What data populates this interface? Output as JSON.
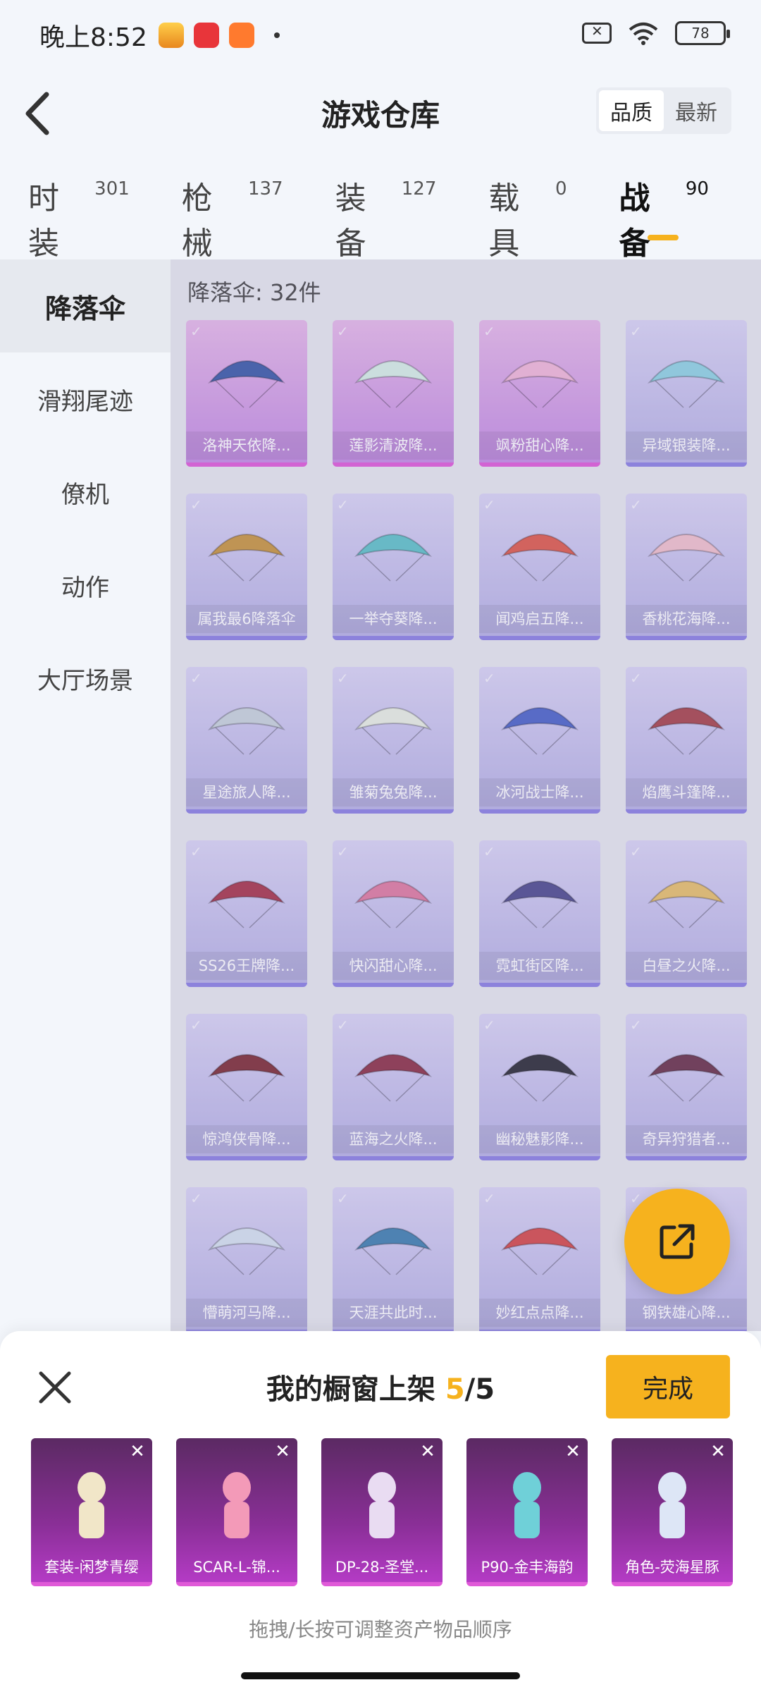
{
  "status": {
    "time": "晚上8:52",
    "battery": "78"
  },
  "header": {
    "title": "游戏仓库",
    "sort_options": [
      "品质",
      "最新"
    ],
    "sort_active": 0
  },
  "tabs": [
    {
      "label": "时装",
      "count": "301"
    },
    {
      "label": "枪械",
      "count": "137"
    },
    {
      "label": "装备",
      "count": "127"
    },
    {
      "label": "载具",
      "count": "0"
    },
    {
      "label": "战备",
      "count": "90"
    }
  ],
  "sidebar": {
    "items": [
      "降落伞",
      "滑翔尾迹",
      "僚机",
      "动作",
      "大厅场景"
    ]
  },
  "grid": {
    "heading": "降落伞: 32件",
    "items": [
      {
        "name": "洛神天依降...",
        "rarity": "legend",
        "color": "#3a5aa8"
      },
      {
        "name": "莲影清波降...",
        "rarity": "legend",
        "color": "#d7efe6"
      },
      {
        "name": "飒粉甜心降...",
        "rarity": "legend",
        "color": "#f2b8d8"
      },
      {
        "name": "异域银装降...",
        "rarity": "epic",
        "color": "#8fd3e3"
      },
      {
        "name": "属我最6降落伞",
        "rarity": "epic",
        "color": "#c8953e"
      },
      {
        "name": "一举夺葵降...",
        "rarity": "epic",
        "color": "#5fc3c8"
      },
      {
        "name": "闻鸡启五降...",
        "rarity": "epic",
        "color": "#e05a4a"
      },
      {
        "name": "香桃花海降...",
        "rarity": "epic",
        "color": "#f2c1cc"
      },
      {
        "name": "星途旅人降...",
        "rarity": "epic",
        "color": "#c9d3dc"
      },
      {
        "name": "雏菊兔兔降...",
        "rarity": "epic",
        "color": "#e9f0e3"
      },
      {
        "name": "冰河战士降...",
        "rarity": "epic",
        "color": "#4b63c9"
      },
      {
        "name": "焰鹰斗篷降...",
        "rarity": "epic",
        "color": "#a8434a"
      },
      {
        "name": "SS26王牌降...",
        "rarity": "epic",
        "color": "#a8344a"
      },
      {
        "name": "快闪甜心降...",
        "rarity": "epic",
        "color": "#e07aa0"
      },
      {
        "name": "霓虹街区降...",
        "rarity": "epic",
        "color": "#4d4a8e"
      },
      {
        "name": "白昼之火降...",
        "rarity": "epic",
        "color": "#e8c06a"
      },
      {
        "name": "惊鸿侠骨降...",
        "rarity": "epic",
        "color": "#7e2b34"
      },
      {
        "name": "蓝海之火降...",
        "rarity": "epic",
        "color": "#8d3046"
      },
      {
        "name": "幽秘魅影降...",
        "rarity": "epic",
        "color": "#2a2a34"
      },
      {
        "name": "奇异狩猎者...",
        "rarity": "epic",
        "color": "#6a3048"
      },
      {
        "name": "懵萌河马降...",
        "rarity": "epic",
        "color": "#d6e2ef"
      },
      {
        "name": "天涯共此时...",
        "rarity": "epic",
        "color": "#3f7fb0"
      },
      {
        "name": "妙红点点降...",
        "rarity": "epic",
        "color": "#d64848"
      },
      {
        "name": "钢铁雄心降...",
        "rarity": "epic",
        "color": "#7a6a8c"
      }
    ]
  },
  "share_button": {
    "icon": "share-icon"
  },
  "sheet": {
    "title_prefix": "我的橱窗上架",
    "count_current": "5",
    "count_total": "/5",
    "done_label": "完成",
    "hint": "拖拽/长按可调整资产物品顺序",
    "items": [
      {
        "name": "套装-闲梦青缨",
        "color": "#f1e6c8"
      },
      {
        "name": "SCAR-L-锦...",
        "color": "#f39ab8"
      },
      {
        "name": "DP-28-圣堂...",
        "color": "#e9dcf2"
      },
      {
        "name": "P90-金丰海韵",
        "color": "#6fd0d8"
      },
      {
        "name": "角色-荧海星豚",
        "color": "#dde6f6"
      }
    ]
  },
  "colors": {
    "accent": "#f6b21e",
    "legend_border": "#e05ad8",
    "epic_border": "#8a7fe3"
  }
}
